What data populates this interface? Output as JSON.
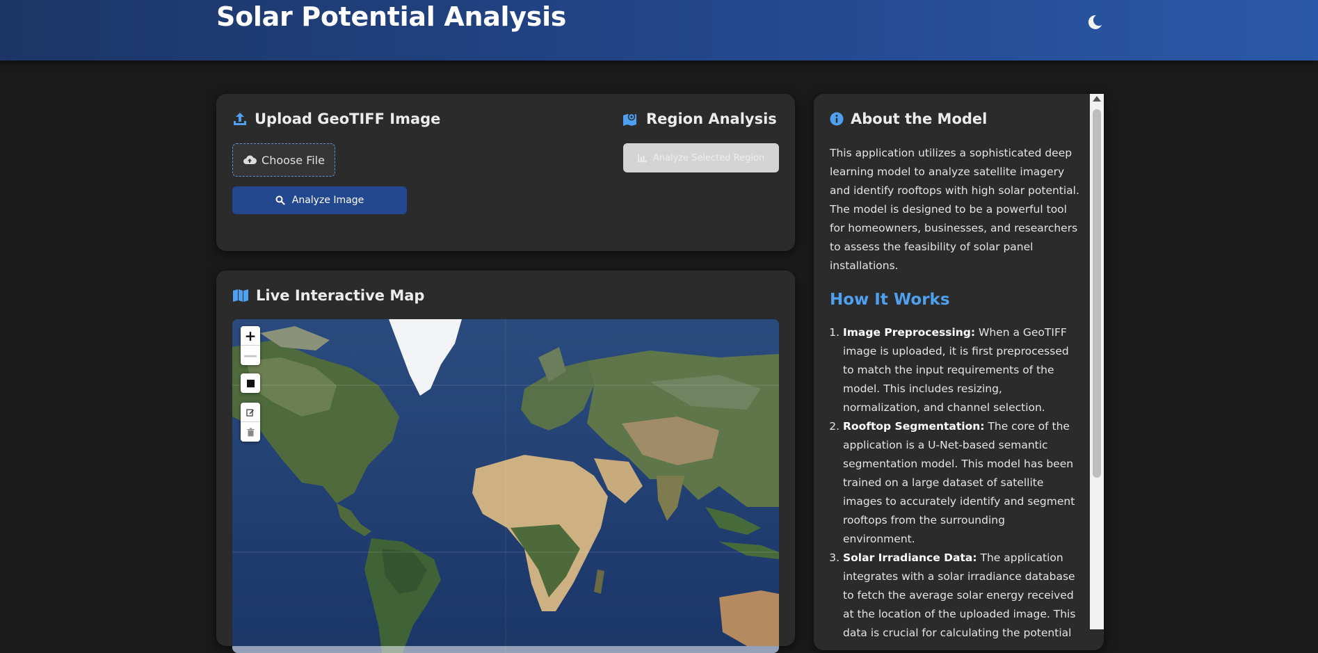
{
  "header": {
    "title": "Solar Potential Analysis",
    "theme_toggle_icon": "moon-icon"
  },
  "upload": {
    "title": "Upload GeoTIFF Image",
    "icon": "upload-icon",
    "choose_file_label": "Choose File",
    "choose_file_icon": "cloud-upload-icon",
    "analyze_label": "Analyze Image",
    "analyze_icon": "search-icon"
  },
  "region": {
    "title": "Region Analysis",
    "icon": "map-marker-icon",
    "analyze_label": "Analyze Selected Region",
    "analyze_icon": "chart-icon",
    "analyze_disabled": true
  },
  "map": {
    "title": "Live Interactive Map",
    "icon": "map-icon",
    "zoom_in": "+",
    "zoom_out": "—",
    "tools": [
      "draw-rectangle-icon",
      "edit-icon",
      "trash-icon"
    ]
  },
  "about": {
    "title": "About the Model",
    "icon": "info-icon",
    "description": "This application utilizes a sophisticated deep learning model to analyze satellite imagery and identify rooftops with high solar potential. The model is designed to be a powerful tool for homeowners, businesses, and researchers to assess the feasibility of solar panel installations.",
    "how_title": "How It Works",
    "steps": [
      {
        "label": "Image Preprocessing:",
        "text": " When a GeoTIFF image is uploaded, it is first preprocessed to match the input requirements of the model. This includes resizing, normalization, and channel selection."
      },
      {
        "label": "Rooftop Segmentation:",
        "text": " The core of the application is a U-Net-based semantic segmentation model. This model has been trained on a large dataset of satellite images to accurately identify and segment rooftops from the surrounding environment."
      },
      {
        "label": "Solar Irradiance Data:",
        "text": " The application integrates with a solar irradiance database to fetch the average solar energy received at the location of the uploaded image. This data is crucial for calculating the potential"
      }
    ]
  },
  "colors": {
    "header_start": "#1c3566",
    "header_end": "#2a58a8",
    "accent": "#4fa0f0",
    "card_bg": "#2b2b2b",
    "page_bg": "#1a1a1a",
    "primary_button": "#24488f"
  }
}
